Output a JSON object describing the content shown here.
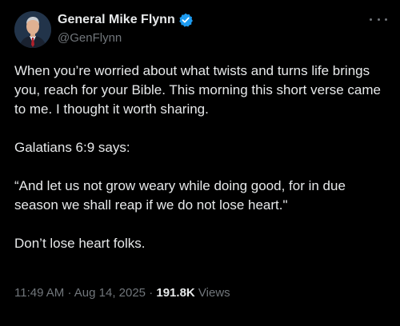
{
  "author": {
    "display_name": "General Mike Flynn",
    "handle": "@GenFlynn",
    "verified": true,
    "verified_badge_color": "#1d9bf0"
  },
  "tweet": {
    "paragraphs": [
      "When you’re worried about what twists and turns life brings you, reach for your Bible. This morning this short verse came to me. I thought it worth sharing.",
      "Galatians 6:9 says:",
      "“And let us not grow weary while doing good, for in due season we shall reap if we do not lose heart.\"",
      "Don’t lose heart folks."
    ]
  },
  "meta": {
    "time": "11:49 AM",
    "separator": "·",
    "date": "Aug 14, 2025",
    "views_count": "191.8K",
    "views_label": "Views"
  },
  "icons": {
    "more": "more-options-icon",
    "verified": "verified-badge-icon"
  },
  "colors": {
    "background": "#000000",
    "primary_text": "#e7e9ea",
    "secondary_text": "#71767b"
  }
}
